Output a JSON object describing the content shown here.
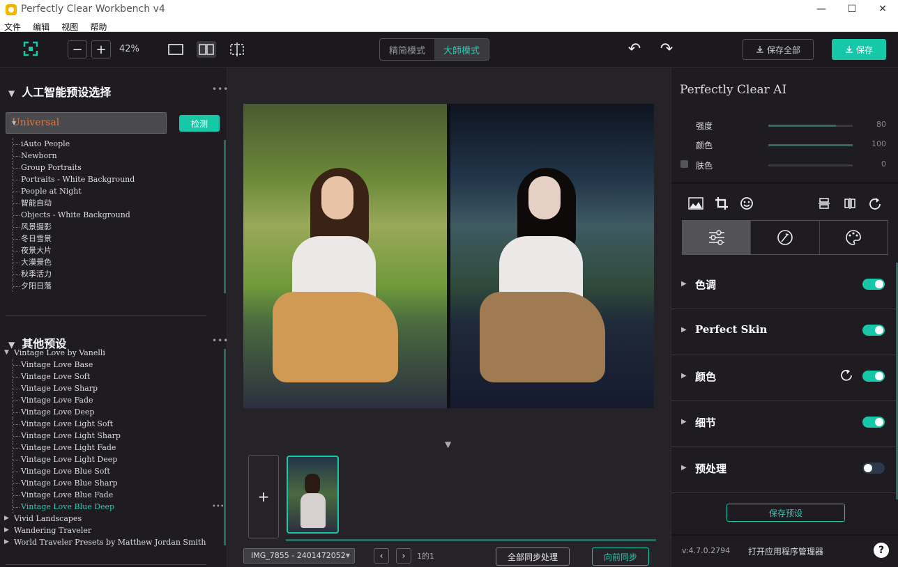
{
  "window": {
    "title": "Perfectly Clear Workbench v4",
    "minimize": "—",
    "maximize": "☐",
    "close": "✕"
  },
  "menu": [
    "文件",
    "编辑",
    "视图",
    "帮助"
  ],
  "toolbar": {
    "zoom_out": "−",
    "zoom_in": "+",
    "zoom": "42%",
    "mode_simple": "精简模式",
    "mode_master": "大師模式",
    "undo": "↶",
    "redo": "↷",
    "save_all": "保存全部",
    "save": "保存"
  },
  "ai_presets": {
    "title": "人工智能预设选择",
    "menu_dots": "•••",
    "selected": "Universal",
    "detect": "检测",
    "items": [
      "iAuto People",
      "Newborn",
      "Group Portraits",
      "Portraits - White Background",
      "People at Night",
      "智能自动",
      "Objects - White Background",
      "风景摄影",
      "冬日雪景",
      "夜景大片",
      "大漠景色",
      "秋季活力",
      "夕阳日落"
    ]
  },
  "other_presets": {
    "title": "其他预设",
    "menu_dots": "•••",
    "group": "Vintage Love by Vanelli",
    "children": [
      "Vintage Love Base",
      "Vintage Love Soft",
      "Vintage Love Sharp",
      "Vintage Love Fade",
      "Vintage Love Deep",
      "Vintage Love Light Soft",
      "Vintage Love Light Sharp",
      "Vintage Love Light Fade",
      "Vintage Love Light Deep",
      "Vintage Love Blue Soft",
      "Vintage Love Blue Sharp",
      "Vintage Love Blue Fade",
      "Vintage Love Blue Deep"
    ],
    "selected_child": "Vintage Love Blue Deep",
    "item_dots": "•••",
    "more_groups": [
      "Vivid Landscapes",
      "Wandering Traveler",
      "World Traveler Presets by Matthew Jordan Smith"
    ]
  },
  "center": {
    "add": "+",
    "file": "IMG_7855 - 2401472052",
    "prev": "‹",
    "next": "›",
    "page": "1的1",
    "sync_all": "全部同步处理",
    "sync_forward": "向前同步"
  },
  "right": {
    "title": "Perfectly Clear AI",
    "sliders": [
      {
        "label": "强度",
        "value": "80",
        "fraction": 0.8
      },
      {
        "label": "颜色",
        "value": "100",
        "fraction": 1.0
      },
      {
        "label": "肤色",
        "value": "0",
        "fraction": 0.0
      }
    ],
    "sections": [
      {
        "label": "色调",
        "on": true
      },
      {
        "label": "Perfect Skin",
        "on": true
      },
      {
        "label": "颜色",
        "on": true
      },
      {
        "label": "细节",
        "on": true
      },
      {
        "label": "预处理",
        "on": false
      }
    ],
    "save_preset": "保存预设",
    "version": "v:4.7.0.2794",
    "open_manager": "打开应用程序管理器",
    "help": "?"
  },
  "colors": {
    "accent": "#16c7a8",
    "preset_highlight": "#e8743b"
  }
}
